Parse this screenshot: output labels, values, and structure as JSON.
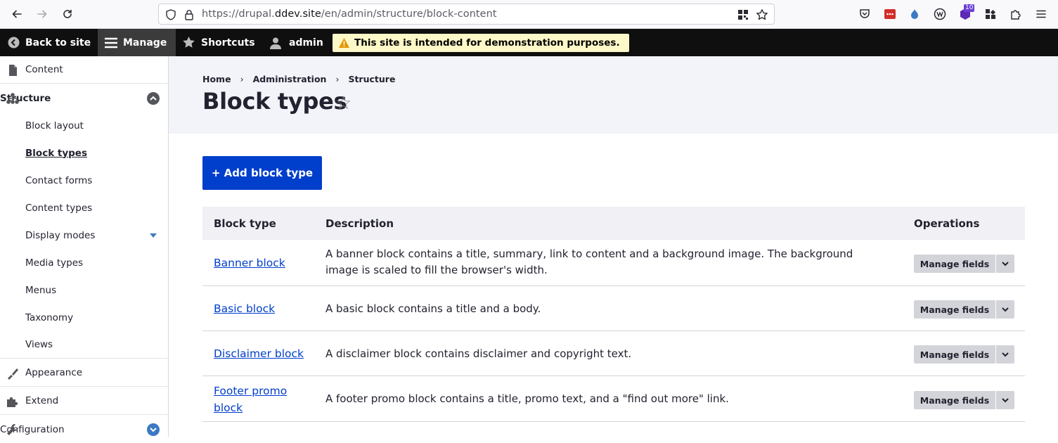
{
  "browser": {
    "url_prefix": "https://drupal.",
    "url_host": "ddev.site",
    "url_path": "/en/admin/structure/block-content",
    "badge_count": "10"
  },
  "toolbar": {
    "back_to_site": "Back to site",
    "manage": "Manage",
    "shortcuts": "Shortcuts",
    "user": "admin",
    "demo_message": "This site is intended for demonstration purposes."
  },
  "sidebar": {
    "content": "Content",
    "structure": "Structure",
    "sub_items": [
      "Block layout",
      "Block types",
      "Contact forms",
      "Content types",
      "Display modes",
      "Media types",
      "Menus",
      "Taxonomy",
      "Views"
    ],
    "appearance": "Appearance",
    "extend": "Extend",
    "configuration": "Configuration"
  },
  "header": {
    "breadcrumb": [
      "Home",
      "Administration",
      "Structure"
    ],
    "breadcrumb_separator": "›",
    "title": "Block types"
  },
  "main": {
    "add_button": "+ Add block type",
    "table": {
      "columns": [
        "Block type",
        "Description",
        "Operations"
      ],
      "rows": [
        {
          "name": "Banner block",
          "description": "A banner block contains a title, summary, link to content and a background image. The background image is scaled to fill the browser's width.",
          "operation": "Manage fields"
        },
        {
          "name": "Basic block",
          "description": "A basic block contains a title and a body.",
          "operation": "Manage fields"
        },
        {
          "name": "Disclaimer block",
          "description": "A disclaimer block contains disclaimer and copyright text.",
          "operation": "Manage fields"
        },
        {
          "name": "Footer promo block",
          "description": "A footer promo block contains a title, promo text, and a \"find out more\" link.",
          "operation": "Manage fields"
        }
      ]
    }
  },
  "colors": {
    "primary_button": "#003ecc",
    "link": "#003ecc",
    "toolbar_bg": "#0f0f0f",
    "header_bg": "#f3f4f9"
  }
}
